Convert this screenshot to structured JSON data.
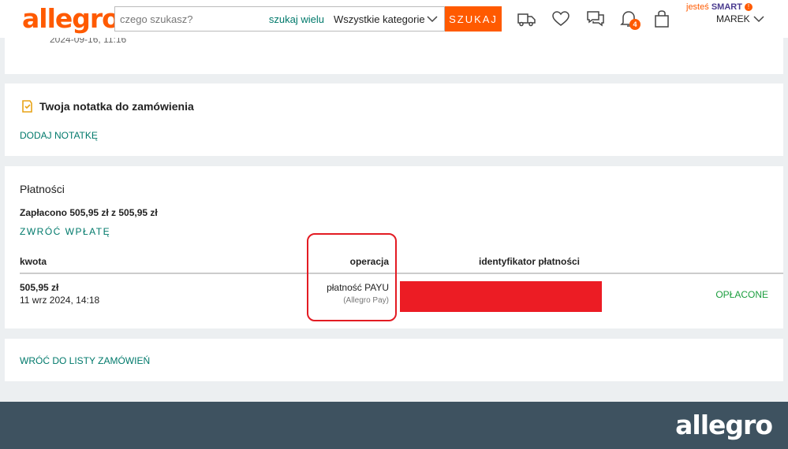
{
  "header": {
    "logo": "allegro",
    "search": {
      "placeholder": "czego szukasz?",
      "value": "",
      "search_many": "szukaj wielu"
    },
    "category": "Wszystkie kategorie",
    "search_button": "SZUKAJ",
    "icons": [
      "delivery-truck-icon",
      "heart-icon",
      "messages-icon",
      "bell-icon",
      "shopping-bag-icon"
    ],
    "notifications_count": "4",
    "smart_prefix": "jesteś",
    "smart_label": "SMART",
    "smart_mark": "!",
    "user_name": "MAREK",
    "accent_color": "#ff5a00"
  },
  "previous_card": {
    "date": "2024-09-16, 11:16"
  },
  "note": {
    "title": "Twoja notatka do zamówienia",
    "add_label": "DODAJ NOTATKĘ"
  },
  "payments": {
    "title": "Płatności",
    "summary": "Zapłacono 505,95 zł z 505,95 zł",
    "refund_label": "ZWRÓĆ WPŁATĘ",
    "columns": {
      "amount": "kwota",
      "operation": "operacja",
      "payment_id": "identyfikator płatności"
    },
    "row": {
      "amount": "505,95 zł",
      "date": "11 wrz 2024, 14:18",
      "operation": "płatność PAYU",
      "operation_sub": "(Allegro Pay)",
      "status": "OPŁACONE",
      "status_color": "#1b9e3e"
    }
  },
  "back": {
    "label": "WRÓĆ DO LISTY ZAMÓWIEŃ"
  },
  "footer": {
    "logo": "allegro"
  }
}
